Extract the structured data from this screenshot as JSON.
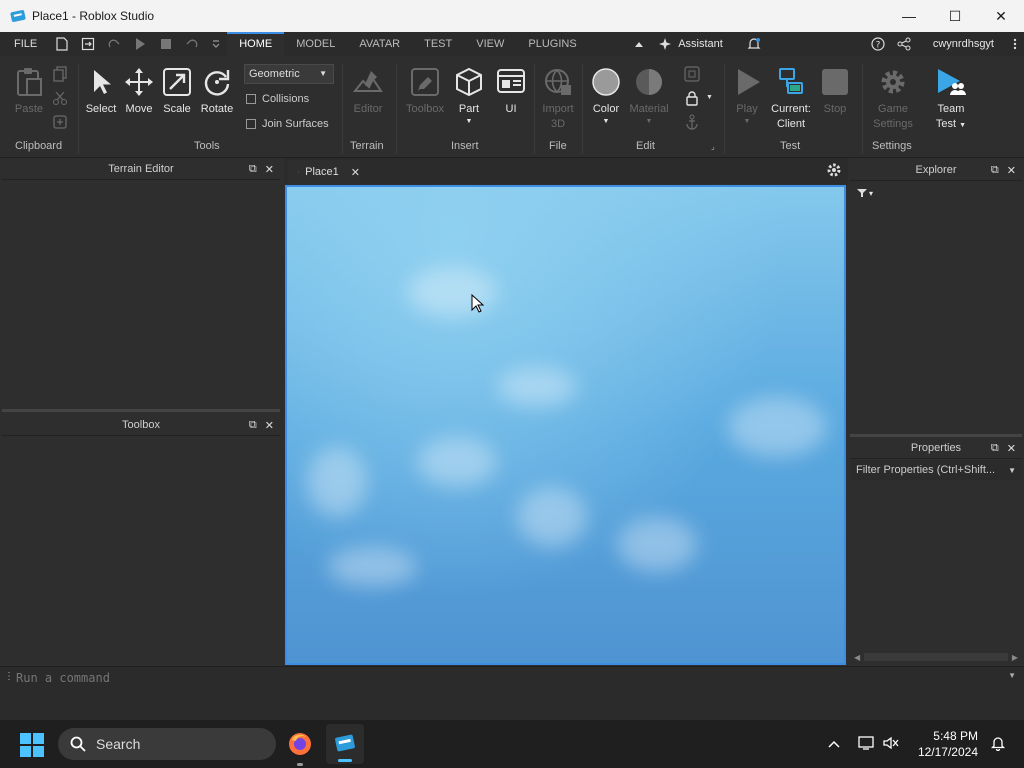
{
  "window": {
    "title": "Place1 - Roblox Studio",
    "minimize": "—",
    "maximize": "☐",
    "close": "✕"
  },
  "menubar": {
    "file": "FILE",
    "tabs": [
      "HOME",
      "MODEL",
      "AVATAR",
      "TEST",
      "VIEW",
      "PLUGINS"
    ],
    "assistant": "Assistant",
    "username": "cwynrdhsgyt"
  },
  "ribbon": {
    "geometric": "Geometric",
    "collisions": "Collisions",
    "join_surfaces": "Join Surfaces",
    "items": {
      "paste": "Paste",
      "select": "Select",
      "move": "Move",
      "scale": "Scale",
      "rotate": "Rotate",
      "editor": "Editor",
      "toolbox": "Toolbox",
      "part": "Part",
      "ui": "UI",
      "import3d_1": "Import",
      "import3d_2": "3D",
      "color": "Color",
      "material": "Material",
      "play": "Play",
      "current1": "Current:",
      "current2": "Client",
      "stop": "Stop",
      "game1": "Game",
      "game2": "Settings",
      "team1": "Team",
      "team2": "Test"
    },
    "groups": {
      "clipboard": "Clipboard",
      "tools": "Tools",
      "terrain": "Terrain",
      "insert": "Insert",
      "file": "File",
      "edit": "Edit",
      "test": "Test",
      "settings": "Settings"
    }
  },
  "panels": {
    "terrain_editor": "Terrain Editor",
    "toolbox": "Toolbox",
    "explorer": "Explorer",
    "properties": "Properties",
    "filter_properties": "Filter Properties (Ctrl+Shift..."
  },
  "viewport": {
    "tab_label": "Place1"
  },
  "command": {
    "placeholder": "Run a command"
  },
  "taskbar": {
    "search": "Search",
    "time": "5:48 PM",
    "date": "12/17/2024"
  },
  "colors": {
    "accent": "#3b8de6",
    "panel_bg": "#2e2e2e",
    "sky_top": "#84c8ec",
    "sky_bottom": "#4f94d2"
  }
}
